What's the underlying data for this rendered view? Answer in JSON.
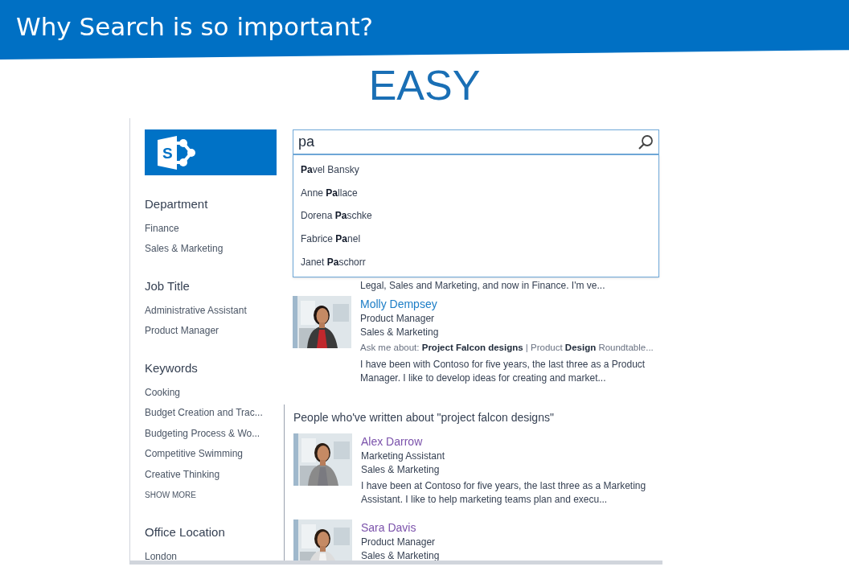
{
  "slide": {
    "title": "Why Search is so important?",
    "subtitle": "EASY"
  },
  "logo": {
    "letter": "S"
  },
  "search": {
    "value": "pa",
    "suggestions": [
      {
        "text": "**Pa**vel Bansky"
      },
      {
        "text": "Anne **Pa**llace"
      },
      {
        "text": "Dorena **Pa**schke"
      },
      {
        "text": "Fabrice **Pa**nel"
      },
      {
        "text": "Janet **Pa**schorr"
      }
    ]
  },
  "refiners": [
    {
      "heading": "Department",
      "items": [
        "Finance",
        "Sales & Marketing"
      ]
    },
    {
      "heading": "Job Title",
      "items": [
        "Administrative Assistant",
        "Product Manager"
      ]
    },
    {
      "heading": "Keywords",
      "items": [
        "Cooking",
        "Budget Creation and Trac...",
        "Budgeting Process & Wo...",
        "Competitive Swimming",
        "Creative Thinking"
      ],
      "show_more": "SHOW MORE"
    },
    {
      "heading": "Office Location",
      "items": [
        "London"
      ]
    }
  ],
  "people_results": [
    {
      "snippet": "Legal, Sales and Marketing, and now in Finance. I'm ve..."
    },
    {
      "kind": "picture",
      "name": "Molly Dempsey",
      "visited": false,
      "title": "Product Manager",
      "department": "Sales & Marketing",
      "ask_me_about": "Ask me about: **Project Falcon designs** | Product **Design** Roundtable...",
      "snippet": "I have been with Contoso for five years, the last three as a Product Manager. I like to develop ideas for creating and market..."
    }
  ],
  "written_about": {
    "heading": "People who've written about \"project falcon designs\"",
    "people": [
      {
        "kind": "picture",
        "name": "Alex Darrow",
        "visited": true,
        "title": "Marketing Assistant",
        "department": "Sales & Marketing",
        "snippet": "I have been at Contoso for five years, the last three as a Marketing Assistant. I like to help marketing teams plan and execu..."
      },
      {
        "kind": "picture",
        "name": "Sara Davis",
        "visited": true,
        "title": "Product Manager",
        "department": "Sales & Marketing"
      }
    ]
  }
}
